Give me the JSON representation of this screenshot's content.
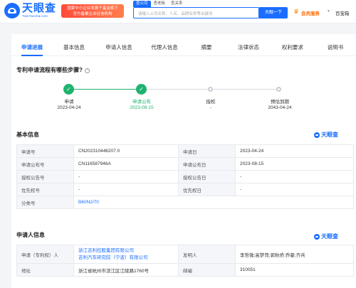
{
  "header": {
    "logo_text": "天眼查",
    "logo_url": "TianYancha.com",
    "notice_line1": "国家中小企业发展子基金旗下",
    "notice_line2": "官方备案企业征信机构",
    "search_tabs": [
      "查公司",
      "查老板",
      "查关系"
    ],
    "search_placeholder": "请输入公司名称、人名、品牌名称等关键词",
    "search_button": "天眼一下",
    "vip_label": "会员服务",
    "extra_link": "百宝箱"
  },
  "tabs": [
    "申请进展",
    "基本信息",
    "申请人信息",
    "代理人信息",
    "摘要",
    "法律状态",
    "权利要求",
    "说明书"
  ],
  "progress": {
    "title": "专利申请流程有哪些步骤?",
    "help_icon": "?",
    "steps": [
      {
        "label": "申请",
        "date": "2023-04-24",
        "state": "done"
      },
      {
        "label": "申请公布",
        "date": "2023-08-15",
        "state": "done"
      },
      {
        "label": "授权",
        "date": "-",
        "state": "todo"
      },
      {
        "label": "预估到期",
        "date": "2043-04-24",
        "state": "todo"
      }
    ]
  },
  "basic": {
    "title": "基本信息",
    "brand": "天眼查",
    "rows": [
      [
        "申请号",
        "CN202310446207.0",
        "申请日",
        "2023-04-24"
      ],
      [
        "申请公布号",
        "CN116587946A",
        "申请公布日",
        "2023-08-15"
      ],
      [
        "授权公告号",
        "-",
        "授权公告日",
        "-"
      ],
      [
        "优先权号",
        "-",
        "优先权日",
        "-"
      ]
    ],
    "class_label": "分类号",
    "class_value": "B60N2/70"
  },
  "applicant": {
    "title": "申请人信息",
    "brand": "天眼查",
    "applicant_label": "申请（专利权）人",
    "applicant_1": "浙江吉利控股集团有限公司",
    "applicant_2": "吉利汽车研究院（宁波）有限公司",
    "inventor_label": "发明人",
    "inventor_value": "李哲微;高梦菏;郭秋侨;乔豪;齐兵",
    "address_label": "地址",
    "address_value": "浙江省杭州市滨江区江陵路1760号",
    "postcode_label": "邮编",
    "postcode_value": "310051"
  },
  "colors": {
    "accent": "#1a6dff",
    "done": "#1fb26f",
    "todo": "#c8ccd2",
    "vip": "#ff6a00"
  },
  "icons": {
    "check": "check-icon",
    "help": "help-circle-icon",
    "logo": "tianyancha-logo-icon"
  }
}
